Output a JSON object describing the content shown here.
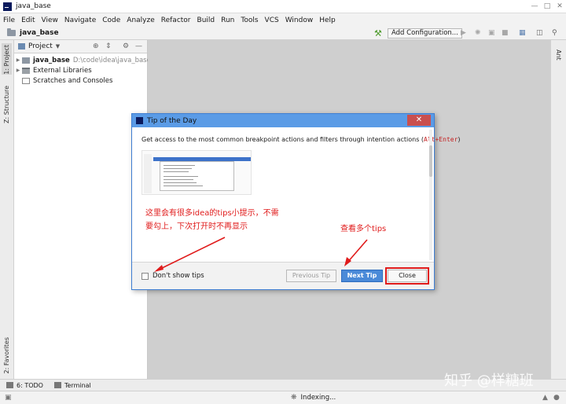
{
  "window": {
    "title": "java_base"
  },
  "menu": [
    "File",
    "Edit",
    "View",
    "Navigate",
    "Code",
    "Analyze",
    "Refactor",
    "Build",
    "Run",
    "Tools",
    "VCS",
    "Window",
    "Help"
  ],
  "toolbar": {
    "project": "java_base",
    "add_config": "Add Configuration..."
  },
  "left_tabs": {
    "project": "1: Project",
    "structure": "Z: Structure",
    "favorites": "2: Favorites"
  },
  "right_tabs": {
    "ant": "Ant"
  },
  "project_panel": {
    "title": "Project",
    "tree": [
      {
        "label": "java_base",
        "path": "D:\\code\\idea\\java_base"
      },
      {
        "label": "External Libraries"
      },
      {
        "label": "Scratches and Consoles"
      }
    ]
  },
  "bottom_tabs": {
    "todo": "6: TODO",
    "terminal": "Terminal"
  },
  "status": {
    "indexing": "Indexing..."
  },
  "dialog": {
    "title": "Tip of the Day",
    "tip_text": "Get access to the most common breakpoint actions and filters through intention actions (",
    "tip_keys": "Alt+Enter",
    "tip_end": ")",
    "checkbox_label": "Don't show tips",
    "prev_label": "Previous Tip",
    "next_label": "Next Tip",
    "close_label": "Close"
  },
  "annotations": {
    "left_line1": "这里会有很多idea的tips小提示，不需",
    "left_line2": "要勾上，下次打开时不再显示",
    "right": "查看多个tips"
  },
  "watermark": "知乎 @样糖班",
  "colors": {
    "annotation": "#e01b1b",
    "dialog_title": "#5a9be6",
    "next_button": "#4a8ad8"
  }
}
